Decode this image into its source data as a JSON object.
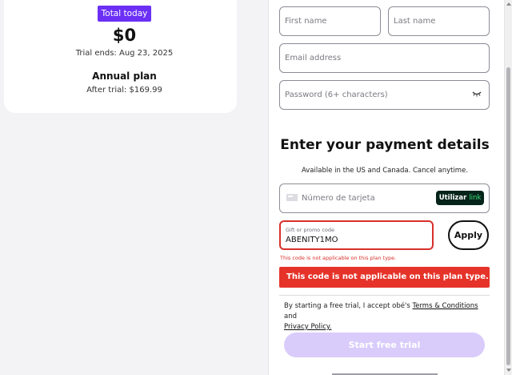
{
  "summary": {
    "badge": "Total today",
    "price": "$0",
    "trial_ends": "Trial ends: Aug 23, 2025",
    "plan_name": "Annual plan",
    "after_trial": "After trial: $169.99"
  },
  "form": {
    "first_name_placeholder": "First name",
    "last_name_placeholder": "Last name",
    "email_placeholder": "Email address",
    "password_placeholder": "Password (6+ characters)",
    "password_toggle_icon": "eye-closed-icon"
  },
  "payment": {
    "heading": "Enter your payment details",
    "subheading": "Available in the US and Canada. Cancel anytime.",
    "card_placeholder": "Número de tarjeta",
    "card_icon": "credit-card-icon",
    "link_button_prefix": "Utilizar",
    "link_button_brand": "link"
  },
  "promo": {
    "label": "Gift or promo code",
    "value": "ABENITY1MO",
    "apply_label": "Apply",
    "error_small": "This code is not applicable on this plan type.",
    "error_banner": "This code is not applicable on this plan type."
  },
  "terms": {
    "prefix": "By starting a free trial, I accept obé's ",
    "terms_link": "Terms & Conditions",
    "middle": " and",
    "privacy_link": "Privacy Policy."
  },
  "cta": {
    "start_label": "Start free trial"
  },
  "colors": {
    "brand_purple": "#6b2ff5",
    "error_red": "#e5332a",
    "cta_disabled": "#d9ccfb",
    "link_green": "#3fe07a"
  }
}
